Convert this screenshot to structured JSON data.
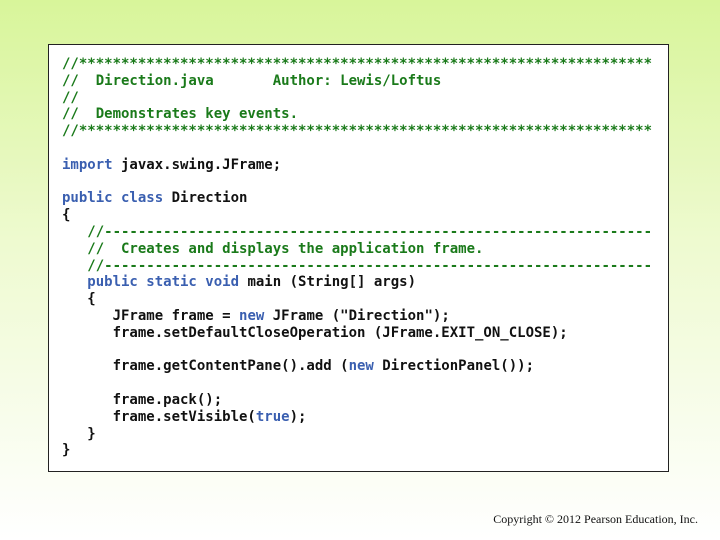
{
  "code_lines": [
    [
      {
        "t": "//********************************************************************",
        "c": "c"
      }
    ],
    [
      {
        "t": "//  Direction.java       Author: Lewis/Loftus",
        "c": "c"
      }
    ],
    [
      {
        "t": "//",
        "c": "c"
      }
    ],
    [
      {
        "t": "//  Demonstrates key events.",
        "c": "c"
      }
    ],
    [
      {
        "t": "//********************************************************************",
        "c": "c"
      }
    ],
    [],
    [
      {
        "t": "import",
        "c": "k"
      },
      {
        "t": " javax.swing.JFrame;",
        "c": "t"
      }
    ],
    [],
    [
      {
        "t": "public class",
        "c": "k"
      },
      {
        "t": " Direction",
        "c": "t"
      }
    ],
    [
      {
        "t": "{",
        "c": "t"
      }
    ],
    [
      {
        "t": "   //-----------------------------------------------------------------",
        "c": "c"
      }
    ],
    [
      {
        "t": "   //  Creates and displays the application frame.",
        "c": "c"
      }
    ],
    [
      {
        "t": "   //-----------------------------------------------------------------",
        "c": "c"
      }
    ],
    [
      {
        "t": "   public static void",
        "c": "k"
      },
      {
        "t": " main (String[] args)",
        "c": "t"
      }
    ],
    [
      {
        "t": "   {",
        "c": "t"
      }
    ],
    [
      {
        "t": "      JFrame frame = ",
        "c": "t"
      },
      {
        "t": "new",
        "c": "k"
      },
      {
        "t": " JFrame (\"Direction\");",
        "c": "t"
      }
    ],
    [
      {
        "t": "      frame.setDefaultCloseOperation (JFrame.EXIT_ON_CLOSE);",
        "c": "t"
      }
    ],
    [],
    [
      {
        "t": "      frame.getContentPane().add (",
        "c": "t"
      },
      {
        "t": "new",
        "c": "k"
      },
      {
        "t": " DirectionPanel());",
        "c": "t"
      }
    ],
    [],
    [
      {
        "t": "      frame.pack();",
        "c": "t"
      }
    ],
    [
      {
        "t": "      frame.setVisible(",
        "c": "t"
      },
      {
        "t": "true",
        "c": "k"
      },
      {
        "t": ");",
        "c": "t"
      }
    ],
    [
      {
        "t": "   }",
        "c": "t"
      }
    ],
    [
      {
        "t": "}",
        "c": "t"
      }
    ]
  ],
  "footer": {
    "copyright": "Copyright © 2012 Pearson Education, Inc."
  },
  "colors": {
    "comment": "#1a7a1a",
    "keyword": "#3a5fb0",
    "text": "#111111"
  }
}
